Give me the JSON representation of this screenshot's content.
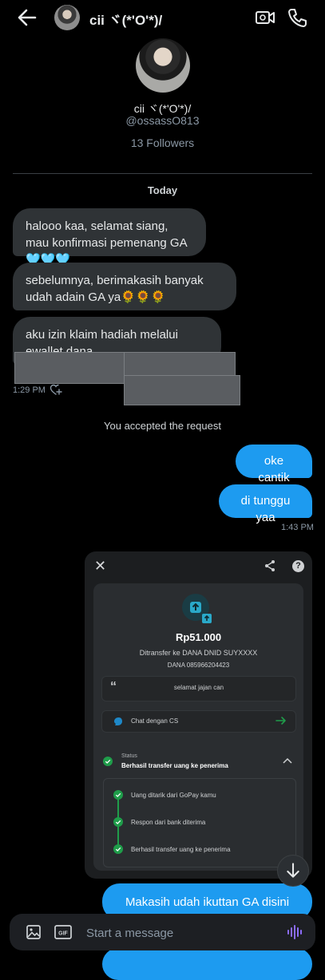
{
  "header": {
    "name": "cii ヾ(*'O'*)/"
  },
  "profile": {
    "name": "cii ヾ(*'O'*)/",
    "handle": "@ossassO813",
    "followers": "13 Followers"
  },
  "conversation": {
    "date_divider": "Today",
    "incoming": [
      {
        "text": "halooo kaa, selamat siang, mau konfirmasi pemenang GA🩵🩵🩵"
      },
      {
        "text": "sebelumnya, berimakasih banyak udah adain GA ya🌻🌻🌻"
      },
      {
        "text": "aku izin klaim hadiah melalui ewallet dana"
      }
    ],
    "incoming_time": "1:29 PM",
    "accepted_notice": "You accepted the request",
    "outgoing": [
      {
        "text": "oke cantik"
      },
      {
        "text": "di tunggu yaa"
      }
    ],
    "outgoing_time": "1:43 PM",
    "last_outgoing": "Makasih udah ikuttan GA disini yaa.."
  },
  "receipt": {
    "help": "?",
    "amount": "Rp51.000",
    "transfer_to": "Ditransfer ke DANA DNID SUYXXXX",
    "account": "DANA 085966204423",
    "note": "selamat jajan can",
    "cs_label": "Chat dengan CS",
    "status_label": "Status",
    "status_value": "Berhasil transfer uang ke penerima",
    "steps": [
      "Uang ditarik dari GoPay kamu",
      "Respon dari bank diterima",
      "Berhasil transfer uang ke penerima"
    ],
    "accent_color": "#1f9d4a"
  },
  "composer": {
    "placeholder": "Start a message",
    "gif_label": "GIF"
  },
  "colors": {
    "outgoing_bubble": "#1d9bf0",
    "incoming_bubble": "#2f3336",
    "background": "#000000"
  }
}
